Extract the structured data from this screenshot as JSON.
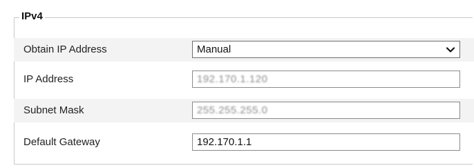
{
  "group": {
    "title": "IPv4"
  },
  "fields": {
    "obtain_ip": {
      "label": "Obtain IP Address",
      "value": "Manual"
    },
    "ip_address": {
      "label": "IP Address",
      "value": "192.170.1.120"
    },
    "subnet_mask": {
      "label": "Subnet Mask",
      "value": "255.255.255.0"
    },
    "default_gateway": {
      "label": "Default Gateway",
      "value": "192.170.1.1"
    }
  },
  "icons": {
    "dropdown": "chevron-down-icon"
  },
  "colors": {
    "row_shade": "#f3f3f3",
    "border": "#c8c8c8"
  }
}
